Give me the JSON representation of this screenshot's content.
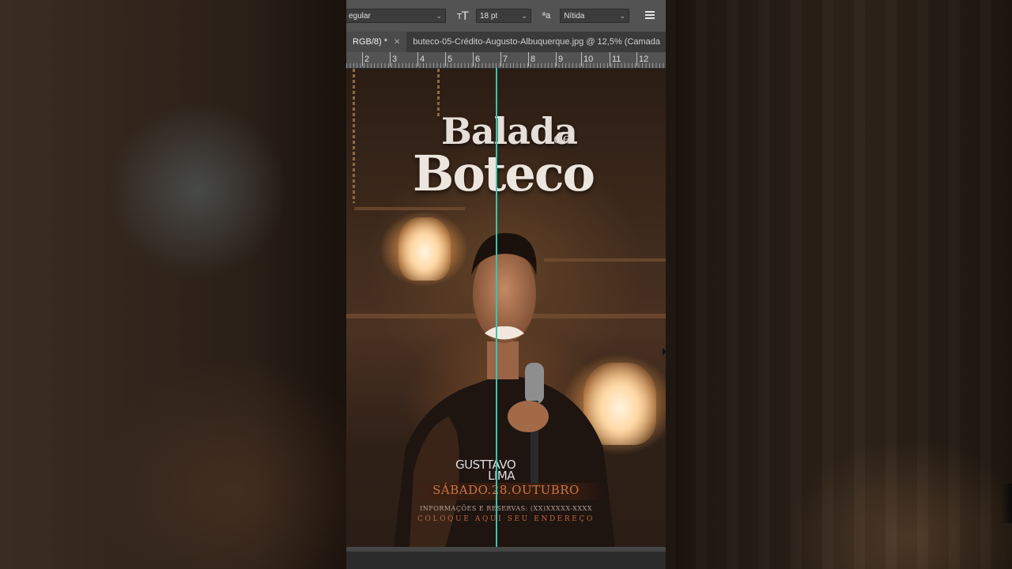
{
  "options_bar": {
    "font_style": "egular",
    "font_size": "18 pt",
    "antialias_icon_label": "ªa",
    "antialias": "Nítida"
  },
  "tabs": [
    {
      "label": "RGB/8) *",
      "active": true
    },
    {
      "label": "buteco-05-Crédito-Augusto-Albuquerque.jpg @ 12,5% (Camada",
      "active": false
    }
  ],
  "ruler": {
    "labels": [
      "2",
      "3",
      "4",
      "5",
      "6",
      "7",
      "8",
      "9",
      "10",
      "11",
      "12"
    ]
  },
  "poster": {
    "title_line1": "Balada",
    "title_de": "de",
    "title_line2": "Boteco",
    "artist_line1": "GUSTTAVO",
    "artist_line2": "LIMA",
    "date": "SÁBADO.28.OUTUBRO",
    "info": "INFORMAÇÕES E RESERVAS: (XX)XXXXX-XXXX",
    "address": "COLOQUE AQUI SEU ENDEREÇO"
  },
  "colors": {
    "guide": "#35c7b0",
    "date_text": "#c8744a",
    "address_text": "#c0663e"
  }
}
